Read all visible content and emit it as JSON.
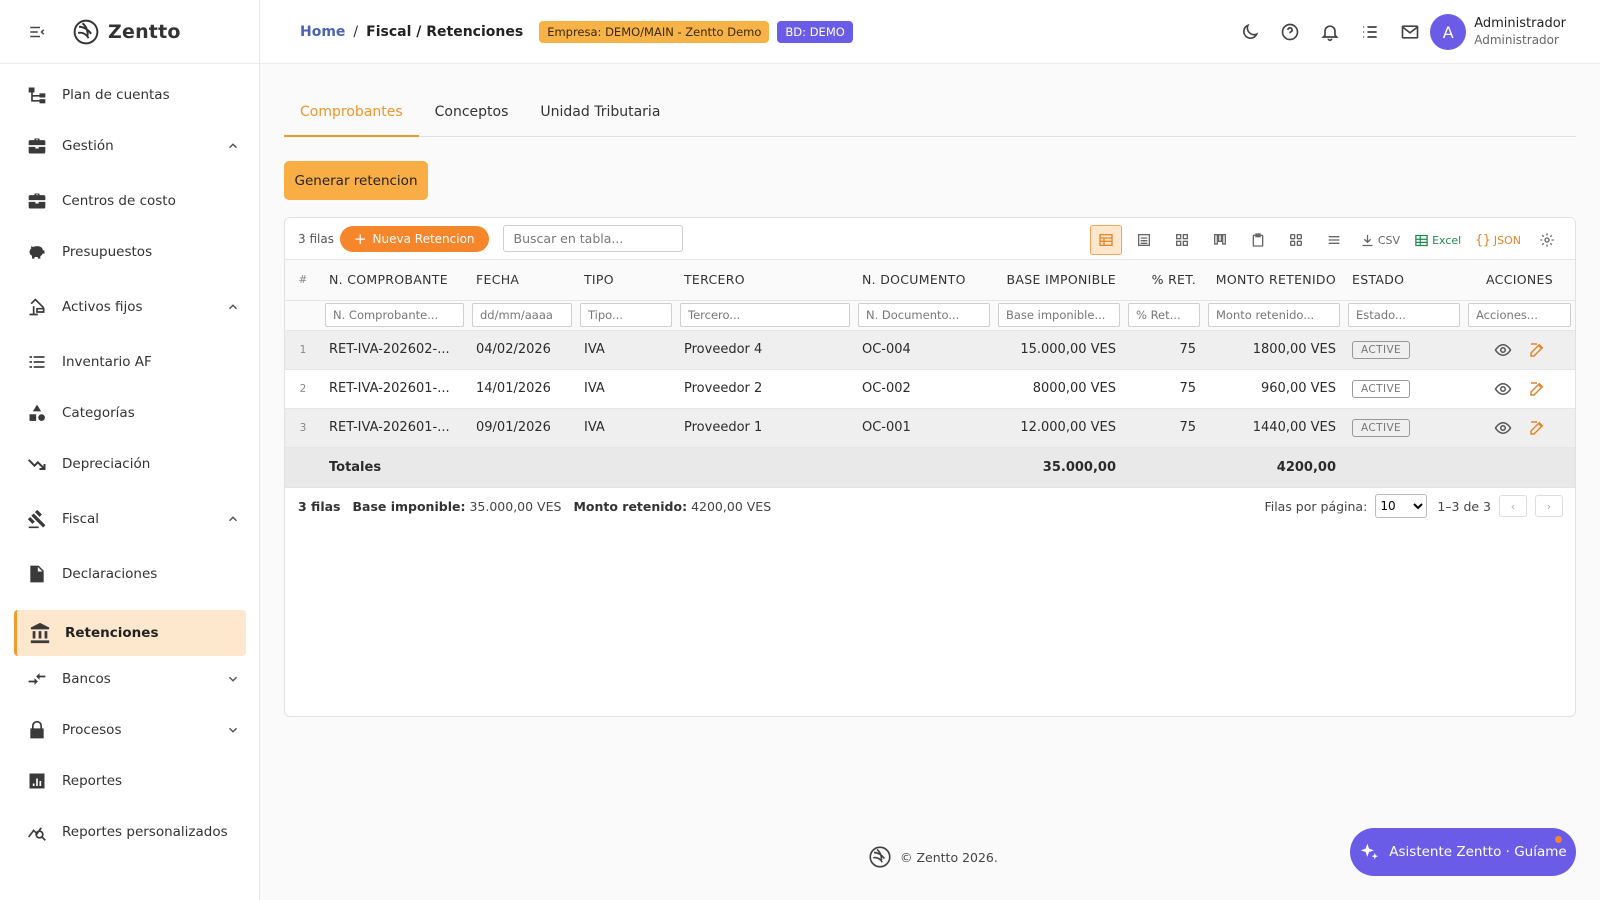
{
  "app": {
    "name": "Zentto",
    "copyright": "© Zentto 2026."
  },
  "breadcrumb": {
    "home": "Home",
    "separator": "/",
    "current": "Fiscal / Retenciones"
  },
  "badges": {
    "empresa": "Empresa: DEMO/MAIN - Zentto Demo",
    "bd": "BD: DEMO"
  },
  "user": {
    "initial": "A",
    "name": "Administrador",
    "role": "Administrador"
  },
  "sidebar": {
    "items": [
      {
        "label": "Plan de cuentas",
        "icon": "account-tree-icon"
      },
      {
        "label": "Gestión",
        "icon": "briefcase-icon",
        "expand": "up"
      },
      {
        "label": "Centros de costo",
        "icon": "briefcase-icon"
      },
      {
        "label": "Presupuestos",
        "icon": "piggy-bank-icon"
      },
      {
        "label": "Activos fijos",
        "icon": "assets-icon",
        "expand": "up"
      },
      {
        "label": "Inventario AF",
        "icon": "list-icon"
      },
      {
        "label": "Categorías",
        "icon": "category-icon"
      },
      {
        "label": "Depreciación",
        "icon": "trending-down-icon"
      },
      {
        "label": "Fiscal",
        "icon": "gavel-icon",
        "expand": "up"
      },
      {
        "label": "Declaraciones",
        "icon": "document-icon"
      },
      {
        "label": "Retenciones",
        "icon": "bank-icon",
        "active": true
      },
      {
        "label": "Bancos",
        "icon": "compare-arrows-icon",
        "expand": "down"
      },
      {
        "label": "Procesos",
        "icon": "lock-icon",
        "expand": "down"
      },
      {
        "label": "Reportes",
        "icon": "bar-chart-icon"
      },
      {
        "label": "Reportes personalizados",
        "icon": "query-stats-icon"
      }
    ]
  },
  "tabs": [
    {
      "label": "Comprobantes",
      "active": true
    },
    {
      "label": "Conceptos"
    },
    {
      "label": "Unidad Tributaria"
    }
  ],
  "actions": {
    "generate": "Generar retencion"
  },
  "grid": {
    "row_count_label": "3 filas",
    "new_button": "Nueva Retencion",
    "search_placeholder": "Buscar en tabla...",
    "toolbar": {
      "csv": "CSV",
      "excel": "Excel",
      "json": "JSON"
    },
    "columns": [
      "#",
      "N. COMPROBANTE",
      "FECHA",
      "TIPO",
      "TERCERO",
      "N. DOCUMENTO",
      "BASE IMPONIBLE",
      "% RET.",
      "MONTO RETENIDO",
      "ESTADO",
      "ACCIONES"
    ],
    "filters": {
      "comprobante": "N. Comprobante...",
      "fecha": "dd/mm/aaaa",
      "tipo": "Tipo...",
      "tercero": "Tercero...",
      "documento": "N. Documento...",
      "base": "Base imponible...",
      "ret": "% Ret...",
      "monto": "Monto retenido...",
      "estado": "Estado...",
      "acciones": "Acciones..."
    },
    "rows": [
      {
        "idx": "1",
        "comprobante": "RET-IVA-202602-...",
        "fecha": "04/02/2026",
        "tipo": "IVA",
        "tercero": "Proveedor 4",
        "documento": "OC-004",
        "base": "15.000,00 VES",
        "ret": "75",
        "monto": "1800,00 VES",
        "estado": "ACTIVE"
      },
      {
        "idx": "2",
        "comprobante": "RET-IVA-202601-...",
        "fecha": "14/01/2026",
        "tipo": "IVA",
        "tercero": "Proveedor 2",
        "documento": "OC-002",
        "base": "8000,00 VES",
        "ret": "75",
        "monto": "960,00 VES",
        "estado": "ACTIVE"
      },
      {
        "idx": "3",
        "comprobante": "RET-IVA-202601-...",
        "fecha": "09/01/2026",
        "tipo": "IVA",
        "tercero": "Proveedor 1",
        "documento": "OC-001",
        "base": "12.000,00 VES",
        "ret": "75",
        "monto": "1440,00 VES",
        "estado": "ACTIVE"
      }
    ],
    "totals": {
      "label": "Totales",
      "base": "35.000,00",
      "monto": "4200,00"
    },
    "footer": {
      "rows": "3 filas",
      "base_label": "Base imponible:",
      "base_value": "35.000,00 VES",
      "monto_label": "Monto retenido:",
      "monto_value": "4200,00 VES",
      "per_page_label": "Filas por página:",
      "per_page_value": "10",
      "range": "1–3 de 3"
    }
  },
  "assistant": {
    "label": "Asistente Zentto · Guíame"
  },
  "colors": {
    "accent": "#f5862b",
    "brand_purple": "#6b5ce7",
    "active_bg": "#fde7cd"
  }
}
